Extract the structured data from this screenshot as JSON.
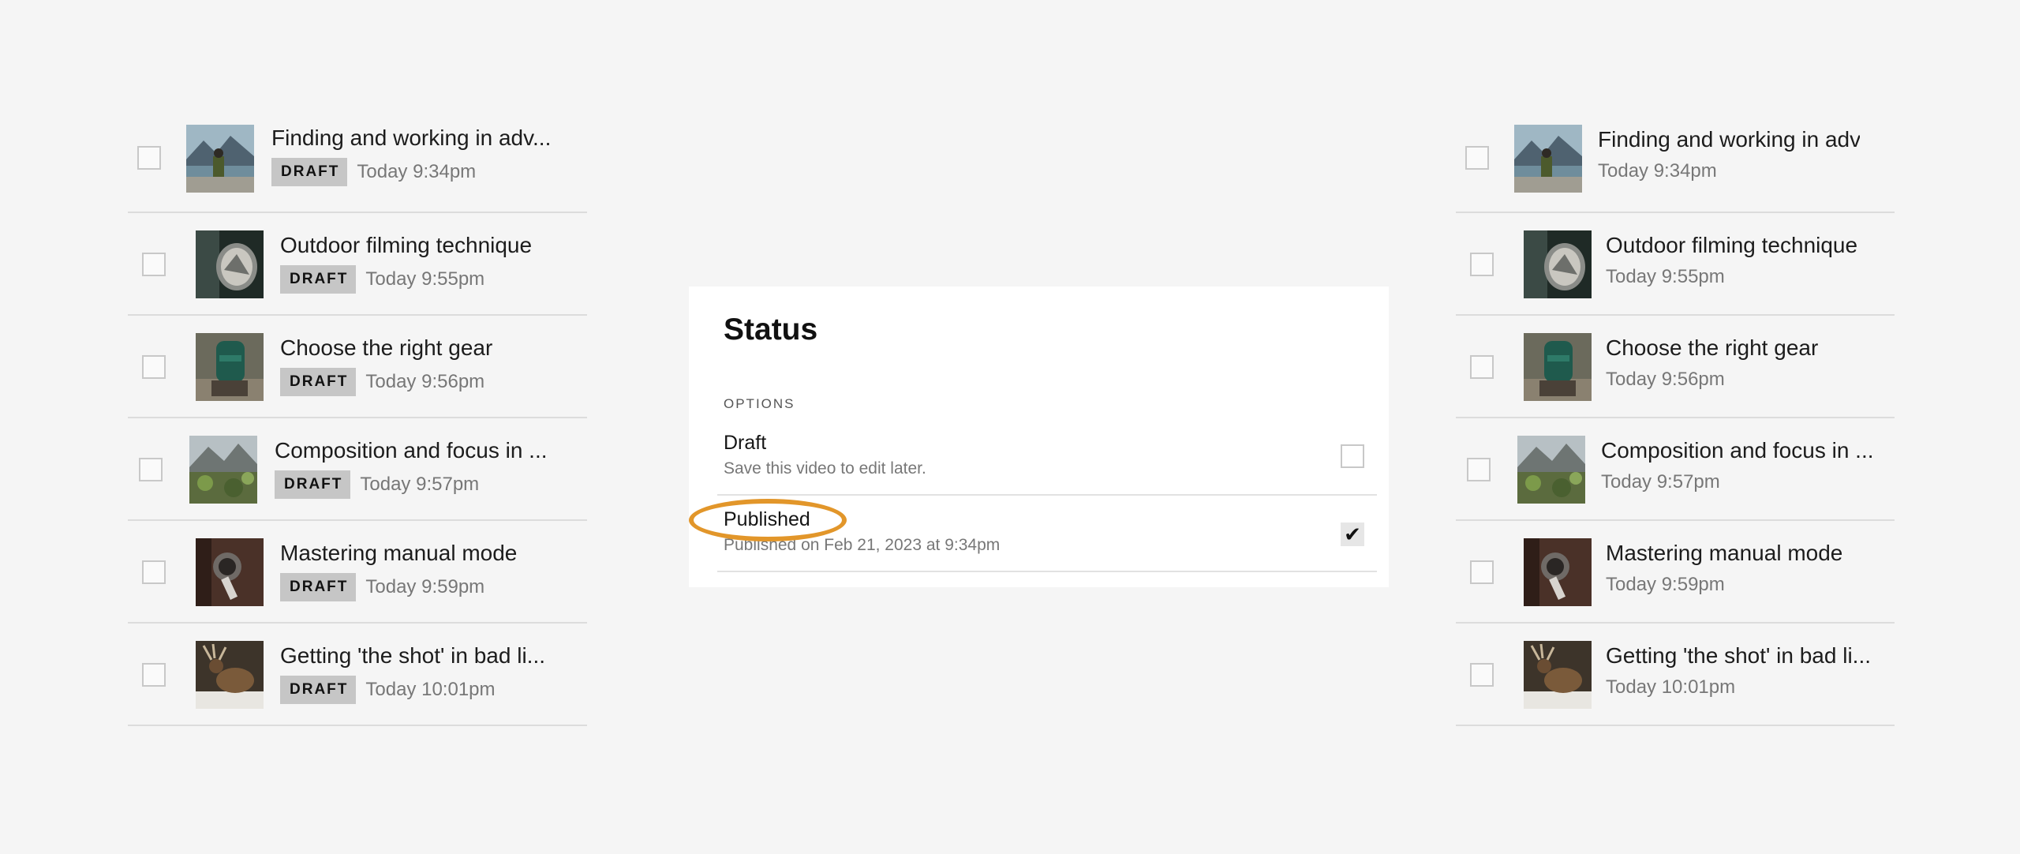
{
  "left_list": {
    "items": [
      {
        "title": "Finding and working in adv...",
        "badge": "DRAFT",
        "time": "Today 9:34pm",
        "thumbnail": "hiker-mountain-lake-photo"
      },
      {
        "title": "Outdoor filming technique",
        "badge": "DRAFT",
        "time": "Today 9:55pm",
        "thumbnail": "car-side-mirror-photo"
      },
      {
        "title": "Choose the right gear",
        "badge": "DRAFT",
        "time": "Today 9:56pm",
        "thumbnail": "green-backpack-photo"
      },
      {
        "title": "Composition and focus in ...",
        "badge": "DRAFT",
        "time": "Today 9:57pm",
        "thumbnail": "mountain-plants-photo"
      },
      {
        "title": "Mastering manual mode",
        "badge": "DRAFT",
        "time": "Today 9:59pm",
        "thumbnail": "camera-lens-tree-photo"
      },
      {
        "title": "Getting 'the shot' in bad li...",
        "badge": "DRAFT",
        "time": "Today 10:01pm",
        "thumbnail": "elk-photo"
      }
    ]
  },
  "right_list": {
    "items": [
      {
        "title": "Finding and working in adv",
        "time": "Today 9:34pm",
        "thumbnail": "hiker-mountain-lake-photo"
      },
      {
        "title": "Outdoor filming technique",
        "time": "Today 9:55pm",
        "thumbnail": "car-side-mirror-photo"
      },
      {
        "title": "Choose the right gear",
        "time": "Today 9:56pm",
        "thumbnail": "green-backpack-photo"
      },
      {
        "title": "Composition and focus in ...",
        "time": "Today 9:57pm",
        "thumbnail": "mountain-plants-photo"
      },
      {
        "title": "Mastering manual mode",
        "time": "Today 9:59pm",
        "thumbnail": "camera-lens-tree-photo"
      },
      {
        "title": "Getting 'the shot' in bad li...",
        "time": "Today 10:01pm",
        "thumbnail": "elk-photo"
      }
    ]
  },
  "status_panel": {
    "title": "Status",
    "options_label": "OPTIONS",
    "options": [
      {
        "label": "Draft",
        "description": "Save this video to edit later.",
        "checked": false
      },
      {
        "label": "Published",
        "description": "Published on Feb 21, 2023 at 9:34pm",
        "checked": true
      }
    ],
    "check_icon": "checkmark-icon"
  },
  "colors": {
    "background": "#f5f5f5",
    "badge": "#c6c6c6",
    "highlight": "#e2962a"
  }
}
